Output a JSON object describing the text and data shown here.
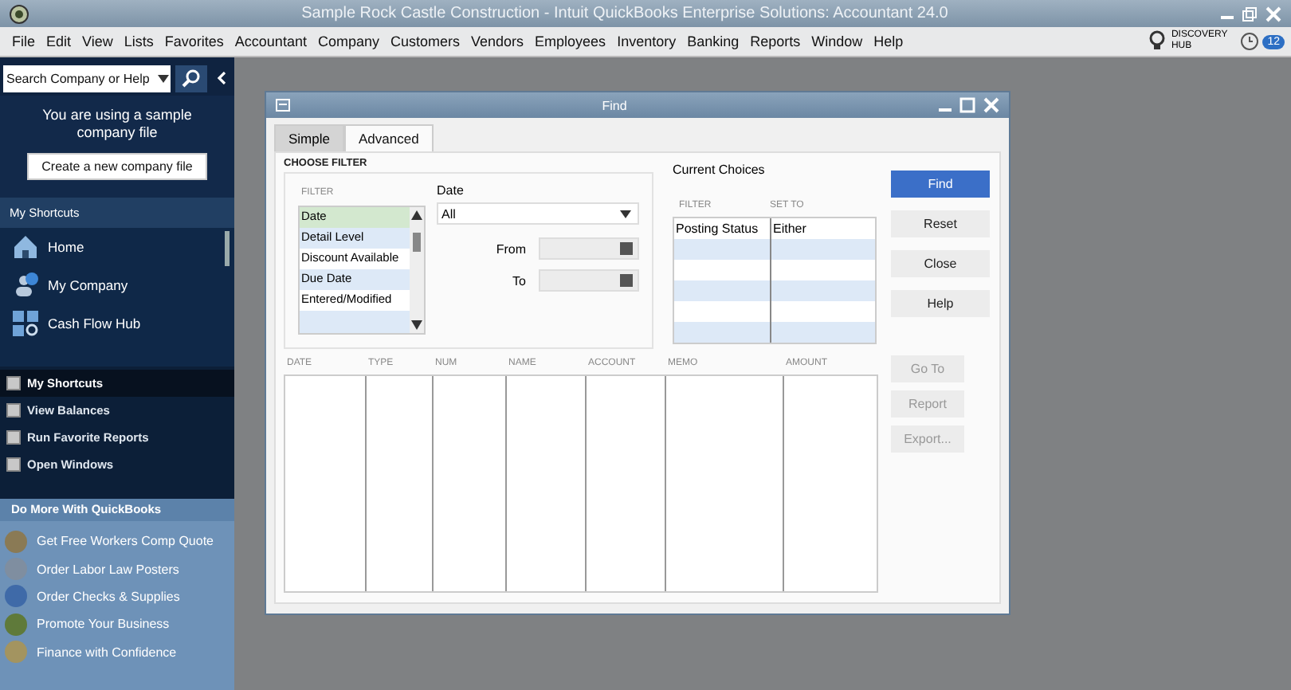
{
  "app_title": "Sample Rock Castle Construction  - Intuit QuickBooks Enterprise Solutions: Accountant 24.0",
  "menu": [
    "File",
    "Edit",
    "View",
    "Lists",
    "Favorites",
    "Accountant",
    "Company",
    "Customers",
    "Vendors",
    "Employees",
    "Inventory",
    "Banking",
    "Reports",
    "Window",
    "Help"
  ],
  "discovery_hub": {
    "line1": "DISCOVERY",
    "line2": "HUB"
  },
  "notification_count": "12",
  "sidebar": {
    "search": {
      "placeholder": "Search Company or Help"
    },
    "sample_note": "You are using a sample company file",
    "create_button": "Create a new company file",
    "shortcuts_header": "My Shortcuts",
    "shortcuts": [
      {
        "label": "Home",
        "kind": "home"
      },
      {
        "label": "My Company",
        "kind": "company"
      },
      {
        "label": "Cash Flow Hub",
        "kind": "hub"
      }
    ],
    "sections": [
      {
        "label": "My Shortcuts",
        "selected": true
      },
      {
        "label": "View Balances",
        "selected": false
      },
      {
        "label": "Run Favorite Reports",
        "selected": false
      },
      {
        "label": "Open Windows",
        "selected": false
      }
    ],
    "more_header": "Do More With QuickBooks",
    "more": [
      {
        "label": "Get Free Workers Comp Quote",
        "color": "#8a7a55"
      },
      {
        "label": "Order Labor Law Posters",
        "color": "#7f8ea0"
      },
      {
        "label": "Order Checks & Supplies",
        "color": "#3f6aa8"
      },
      {
        "label": "Promote Your Business",
        "color": "#5f7a3a"
      },
      {
        "label": "Finance with Confidence",
        "color": "#a39460"
      }
    ]
  },
  "find": {
    "title": "Find",
    "tabs": [
      {
        "label": "Simple",
        "selected": false
      },
      {
        "label": "Advanced",
        "selected": true
      }
    ],
    "choose_filter": "CHOOSE FILTER",
    "filter_header": "FILTER",
    "filters": [
      {
        "label": "Date",
        "selected": true
      },
      {
        "label": "Detail Level",
        "selected": false
      },
      {
        "label": "Discount Available",
        "selected": false
      },
      {
        "label": "Due Date",
        "selected": false
      },
      {
        "label": "Entered/Modified",
        "selected": false
      }
    ],
    "date_label": "Date",
    "date_value": "All",
    "from_label": "From",
    "to_label": "To",
    "current_choices": "Current Choices",
    "choices_columns": [
      "FILTER",
      "SET TO"
    ],
    "choices": [
      [
        "Posting Status",
        "Either"
      ]
    ],
    "buttons": [
      {
        "label": "Find",
        "primary": true,
        "disabled": false
      },
      {
        "label": "Reset",
        "primary": false,
        "disabled": false
      },
      {
        "label": "Close",
        "primary": false,
        "disabled": false
      },
      {
        "label": "Help",
        "primary": false,
        "disabled": false
      }
    ],
    "result_buttons": [
      {
        "label": "Go To",
        "primary": false,
        "disabled": true
      },
      {
        "label": "Report",
        "primary": false,
        "disabled": true
      },
      {
        "label": "Export...",
        "primary": false,
        "disabled": true
      }
    ],
    "columns": [
      "DATE",
      "TYPE",
      "NUM",
      "NAME",
      "ACCOUNT",
      "MEMO",
      "AMOUNT"
    ]
  }
}
